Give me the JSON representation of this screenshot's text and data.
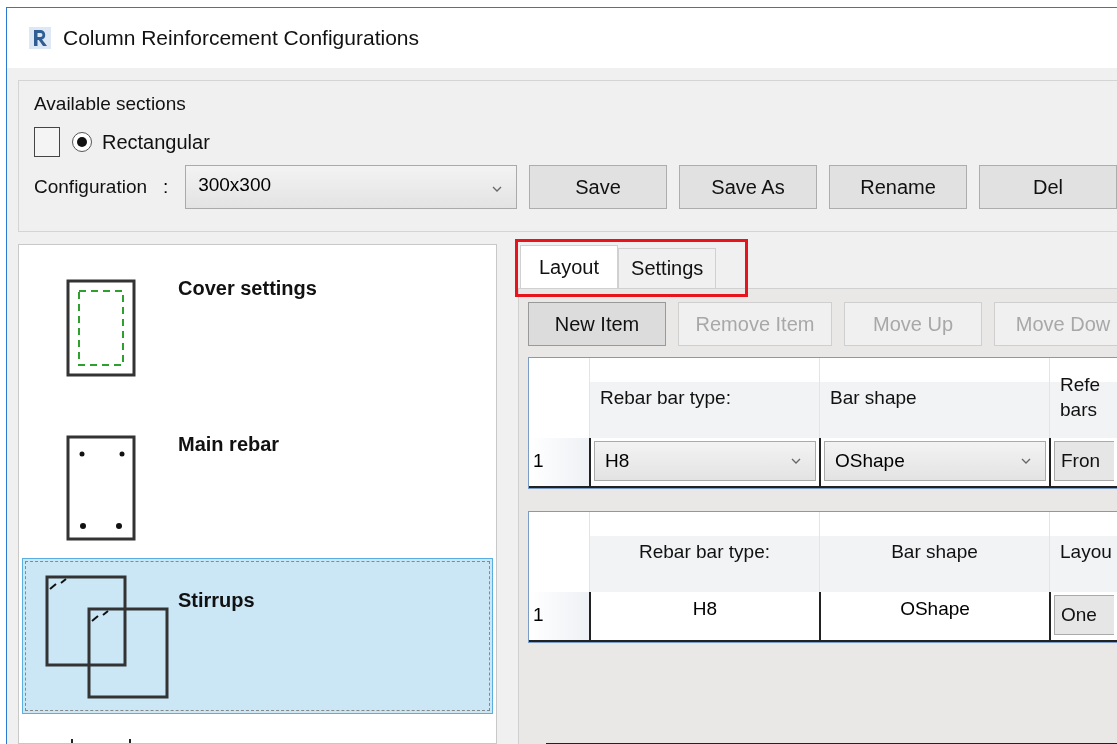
{
  "window": {
    "title": "Column Reinforcement Configurations"
  },
  "available_sections": {
    "label": "Available sections",
    "checkbox": {
      "checked": false
    },
    "radio": {
      "label": "Rectangular",
      "selected": true
    }
  },
  "configuration": {
    "label": "Configuration",
    "separator": ":",
    "value": "300x300"
  },
  "buttons": [
    {
      "label": "Save"
    },
    {
      "label": "Save As"
    },
    {
      "label": "Rename"
    },
    {
      "label": "Del"
    }
  ],
  "sections": [
    {
      "kind": "cover",
      "label": "Cover settings",
      "selected": false
    },
    {
      "kind": "main",
      "label": "Main rebar",
      "selected": false
    },
    {
      "kind": "stirrups",
      "label": "Stirrups",
      "selected": true
    },
    {
      "kind": "ties",
      "selected": false
    }
  ],
  "tabs": [
    {
      "label": "Layout",
      "selected": true
    },
    {
      "label": "Settings",
      "selected": false
    }
  ],
  "highlight": true,
  "toolbar": [
    {
      "label": "New Item",
      "disabled": false
    },
    {
      "label": "Remove Item",
      "disabled": true
    },
    {
      "label": "Move Up",
      "disabled": true
    },
    {
      "label": "Move Dow",
      "disabled": true
    }
  ],
  "grids": [
    {
      "kind": "editable",
      "columns": [
        "Rebar bar type:",
        "Bar shape",
        "Refe\nbars"
      ],
      "rows": [
        {
          "header": "1",
          "cells": [
            {
              "kind": "combo",
              "text": "H8"
            },
            {
              "kind": "combo",
              "text": "OShape"
            },
            {
              "kind": "button",
              "text": "Fron"
            }
          ]
        }
      ]
    },
    {
      "kind": "readonly",
      "columns": [
        "Rebar bar type:",
        "Bar shape",
        "Layou"
      ],
      "rows": [
        {
          "header": "1",
          "cells": [
            {
              "kind": "text",
              "text": "H8"
            },
            {
              "kind": "text",
              "text": "OShape"
            },
            {
              "kind": "button",
              "text": "One"
            }
          ]
        }
      ]
    }
  ]
}
